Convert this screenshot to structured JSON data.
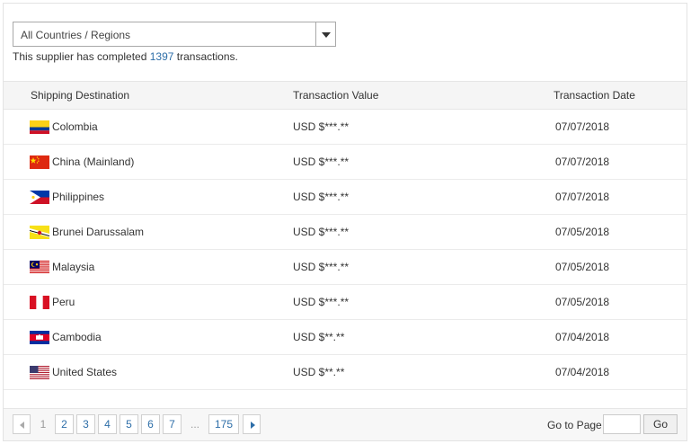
{
  "filter": {
    "selected": "All Countries / Regions"
  },
  "summary": {
    "prefix": "This supplier has completed ",
    "count": "1397",
    "suffix": " transactions."
  },
  "table": {
    "headers": {
      "destination": "Shipping Destination",
      "value": "Transaction Value",
      "date": "Transaction Date"
    },
    "rows": [
      {
        "country": "Colombia",
        "flag": "colombia-flag-icon",
        "value": "USD $***.**",
        "date": "07/07/2018"
      },
      {
        "country": "China (Mainland)",
        "flag": "china-flag-icon",
        "value": "USD $***.**",
        "date": "07/07/2018"
      },
      {
        "country": "Philippines",
        "flag": "philippines-flag-icon",
        "value": "USD $***.**",
        "date": "07/07/2018"
      },
      {
        "country": "Brunei Darussalam",
        "flag": "brunei-flag-icon",
        "value": "USD $***.**",
        "date": "07/05/2018"
      },
      {
        "country": "Malaysia",
        "flag": "malaysia-flag-icon",
        "value": "USD $***.**",
        "date": "07/05/2018"
      },
      {
        "country": "Peru",
        "flag": "peru-flag-icon",
        "value": "USD $***.**",
        "date": "07/05/2018"
      },
      {
        "country": "Cambodia",
        "flag": "cambodia-flag-icon",
        "value": "USD $**.**",
        "date": "07/04/2018"
      },
      {
        "country": "United States",
        "flag": "usa-flag-icon",
        "value": "USD $**.**",
        "date": "07/04/2018"
      }
    ]
  },
  "pagination": {
    "pages": [
      "1",
      "2",
      "3",
      "4",
      "5",
      "6",
      "7"
    ],
    "current": "1",
    "ellipsis": "...",
    "last": "175",
    "goto_label": "Go to Page",
    "goto_value": "",
    "go_label": "Go"
  },
  "colors": {
    "link": "#2d6ea8",
    "header_bg": "#f5f5f5",
    "footer_bg": "#f7f7f7"
  }
}
